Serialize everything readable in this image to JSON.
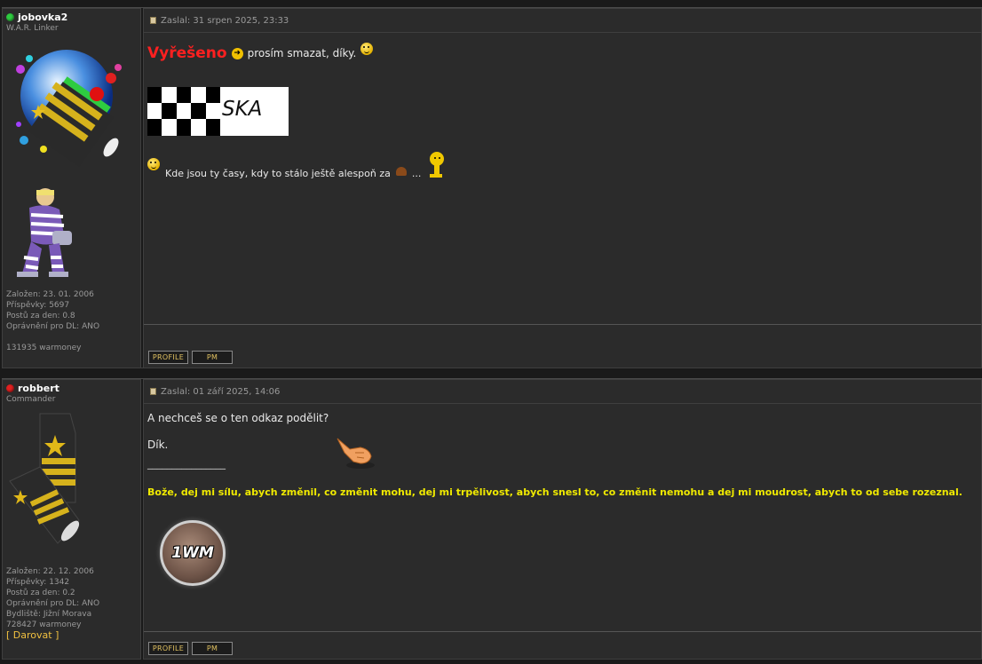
{
  "posts": [
    {
      "username": "jobovka2",
      "status_color": "#2ecc40",
      "rank": "W.A.R. Linker",
      "stats": {
        "joined": "Založen: 23. 01. 2006",
        "posts": "Příspěvky: 5697",
        "per_day": "Postů za den: 0.8",
        "dl": "Oprávnění pro DL: ANO",
        "warmoney": "131935 warmoney"
      },
      "header": "Zaslal: 31 srpen 2025, 23:33",
      "solved": "Vyřešeno",
      "solved_tail": "prosím smazat, díky.",
      "banner_text": "SKA",
      "line2": "Kde jsou ty časy, kdy to stálo ještě alespoň za",
      "line2_tail": "...",
      "buttons": {
        "profile": "PROFILE",
        "pm": "PM"
      }
    },
    {
      "username": "robbert",
      "status_color": "#e02020",
      "rank": "Commander",
      "stats": {
        "joined": "Založen: 22. 12. 2006",
        "posts": "Příspěvky: 1342",
        "per_day": "Postů za den: 0.2",
        "dl": "Oprávnění pro DL: ANO",
        "location": "Bydliště: Jižní Morava",
        "warmoney": "728427 warmoney",
        "donate_open": "[",
        "donate": "Darovat",
        "donate_close": "]"
      },
      "header": "Zaslal: 01 září 2025, 14:06",
      "line1": "A nechceš se o ten odkaz podělit?",
      "line2": "Dík.",
      "divider": "________________",
      "signature": "Bože, dej mi sílu, abych změnil, co změnit mohu, dej mi trpělivost, abych snesl to, co změnit nemohu a dej mi moudrost, abych to od sebe rozeznal.",
      "badge": "1WM",
      "buttons": {
        "profile": "PROFILE",
        "pm": "PM"
      }
    }
  ]
}
